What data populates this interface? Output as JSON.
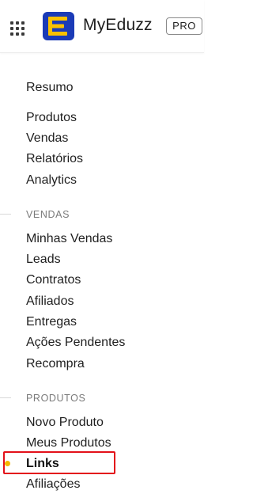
{
  "header": {
    "brand": "MyEduzz",
    "badge": "PRO",
    "brand_colors": {
      "logo_bg": "#1b3bb7",
      "logo_fg": "#fbc100"
    }
  },
  "menu": {
    "summary": "Resumo",
    "main": [
      "Produtos",
      "Vendas",
      "Relatórios",
      "Analytics"
    ],
    "sections": [
      {
        "label": "VENDAS",
        "items": [
          "Minhas Vendas",
          "Leads",
          "Contratos",
          "Afiliados",
          "Entregas",
          "Ações Pendentes",
          "Recompra"
        ]
      },
      {
        "label": "PRODUTOS",
        "items": [
          "Novo Produto",
          "Meus Produtos",
          "Links",
          "Afiliações"
        ]
      }
    ],
    "active_item": "Links",
    "colors": {
      "active_indicator": "#f5b800",
      "highlight_border": "#e3101a"
    }
  }
}
